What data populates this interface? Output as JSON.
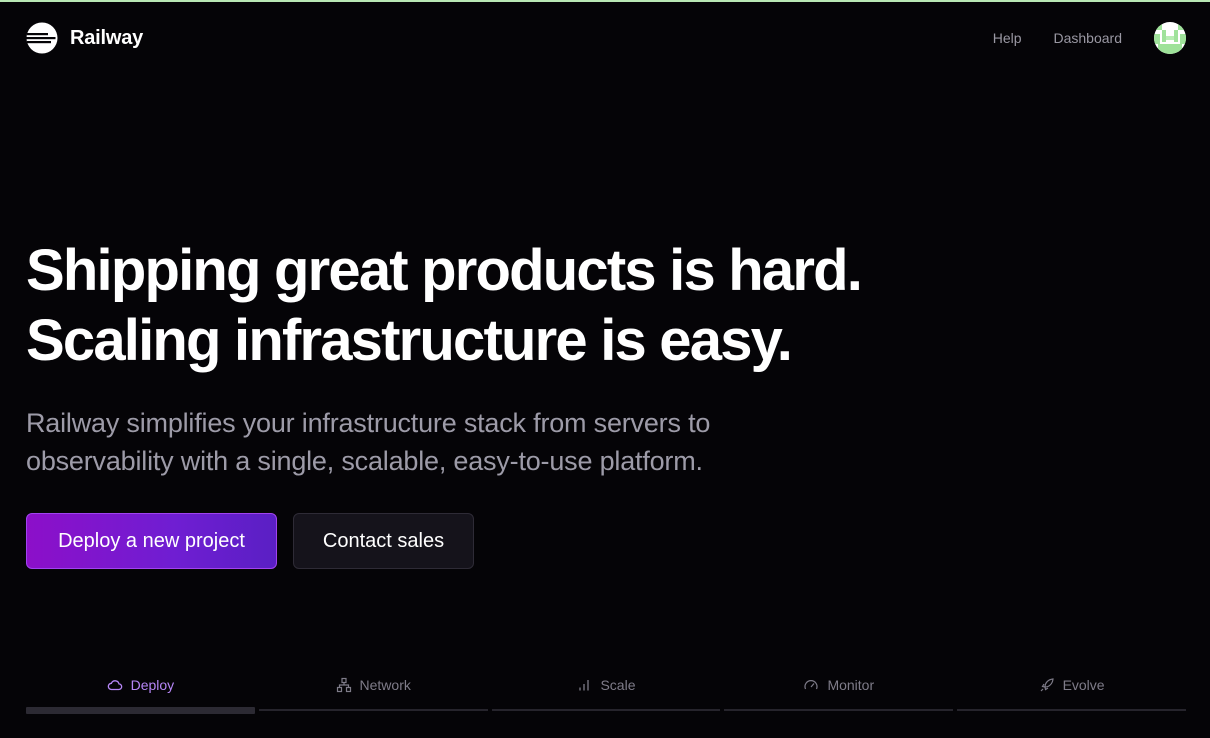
{
  "brand": {
    "name": "Railway",
    "logo_icon": "railway-logo-icon"
  },
  "nav": {
    "help_label": "Help",
    "dashboard_label": "Dashboard",
    "avatar_icon": "user-avatar"
  },
  "hero": {
    "headline_line1": "Shipping great products is hard.",
    "headline_line2": "Scaling infrastructure is easy.",
    "subtitle": "Railway simplifies your infrastructure stack from servers to observability with a single, scalable, easy-to-use platform.",
    "primary_cta": "Deploy a new project",
    "secondary_cta": "Contact sales"
  },
  "tabs": [
    {
      "label": "Deploy",
      "icon": "cloud-icon",
      "active": true
    },
    {
      "label": "Network",
      "icon": "network-icon",
      "active": false
    },
    {
      "label": "Scale",
      "icon": "bar-chart-icon",
      "active": false
    },
    {
      "label": "Monitor",
      "icon": "gauge-icon",
      "active": false
    },
    {
      "label": "Evolve",
      "icon": "rocket-icon",
      "active": false
    }
  ],
  "colors": {
    "background": "#050407",
    "primary": "#8c0fc9",
    "active_tab": "#b686f7",
    "muted_text": "#9d9ba8",
    "top_accent": "#b9e7b4"
  }
}
